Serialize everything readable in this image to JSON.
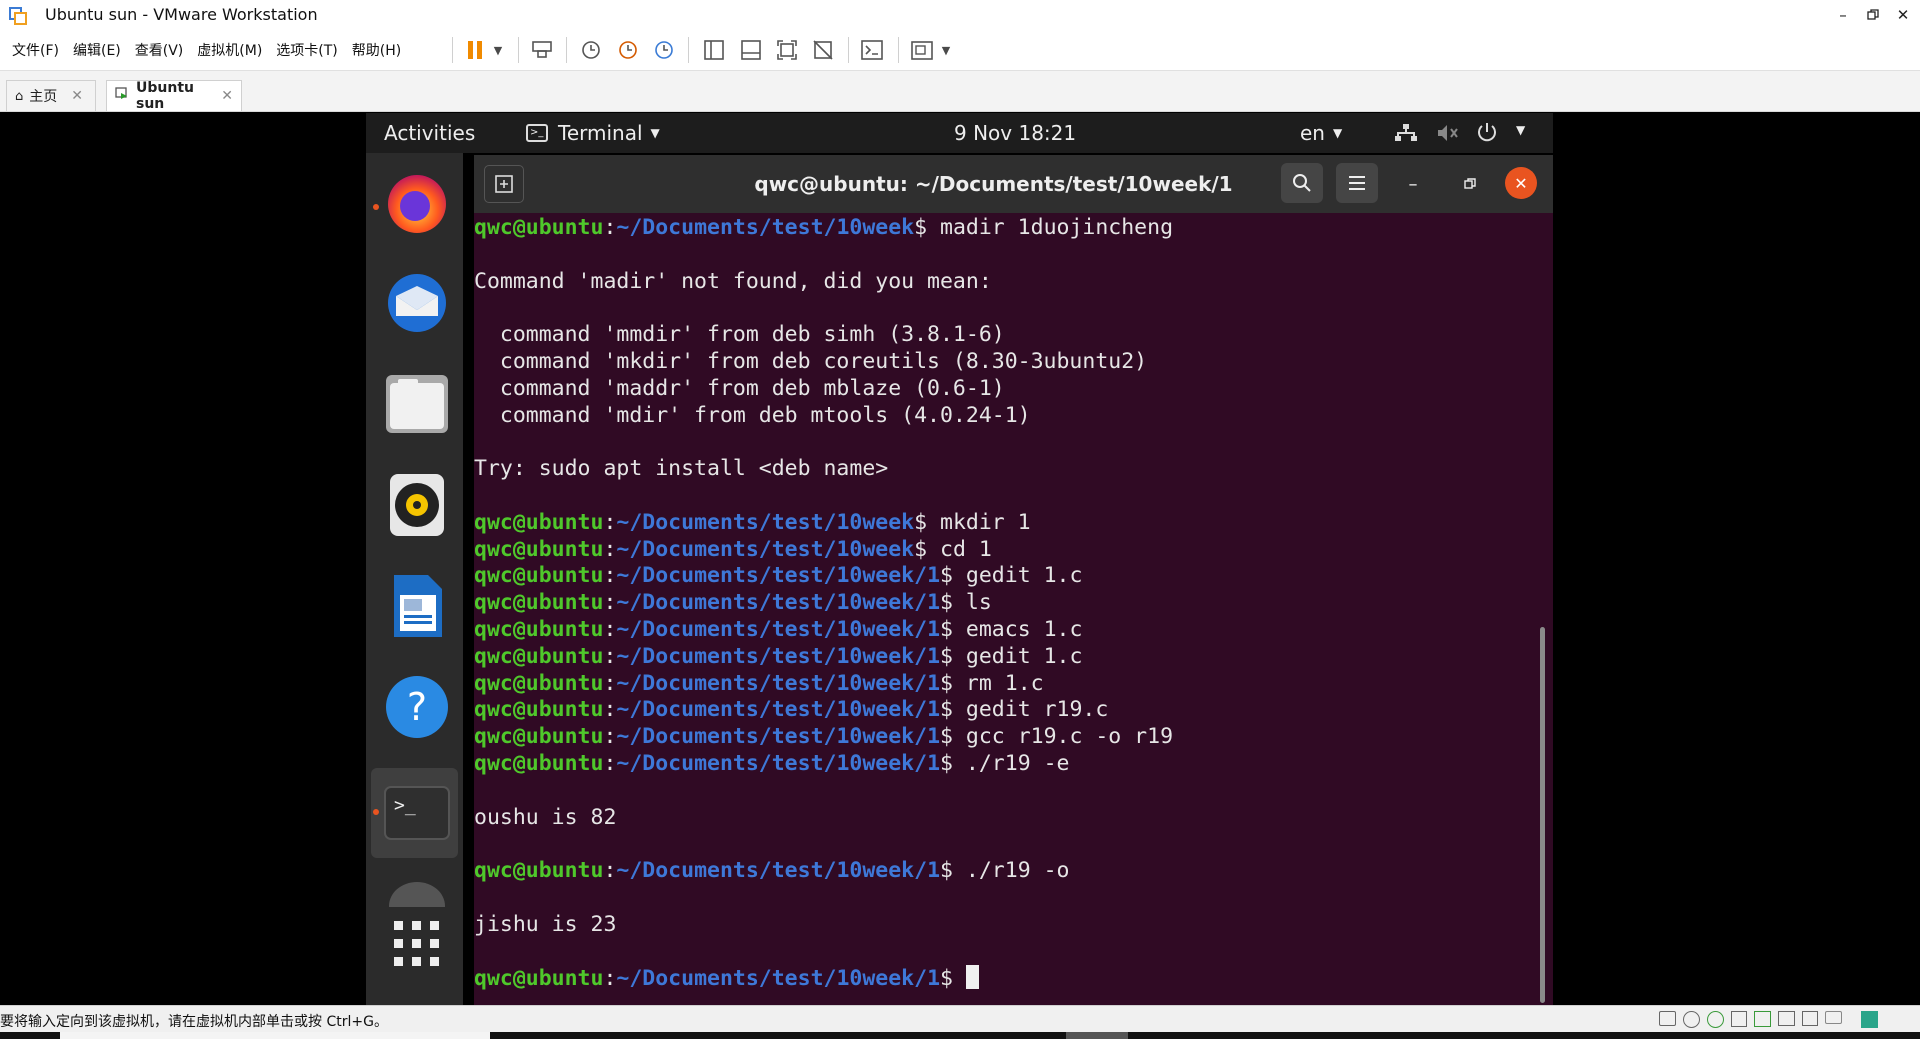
{
  "window": {
    "title": "Ubuntu sun - VMware Workstation"
  },
  "menu": {
    "items": [
      "文件(F)",
      "编辑(E)",
      "查看(V)",
      "虚拟机(M)",
      "选项卡(T)",
      "帮助(H)"
    ]
  },
  "tabs": [
    {
      "label": "主页",
      "active": false
    },
    {
      "label": "Ubuntu sun",
      "active": true
    }
  ],
  "ubuntu_topbar": {
    "activities": "Activities",
    "app_menu": "Terminal",
    "datetime": "9 Nov  18:21",
    "language": "en"
  },
  "terminal": {
    "title": "qwc@ubuntu: ~/Documents/test/10week/1",
    "lines": [
      {
        "type": "prompt",
        "user": "qwc@ubuntu",
        "path": "~/Documents/test/10week",
        "cmd": " madir 1duojincheng"
      },
      {
        "type": "blank"
      },
      {
        "type": "output",
        "text": "Command 'madir' not found, did you mean:"
      },
      {
        "type": "blank"
      },
      {
        "type": "output",
        "text": "  command 'mmdir' from deb simh (3.8.1-6)"
      },
      {
        "type": "output",
        "text": "  command 'mkdir' from deb coreutils (8.30-3ubuntu2)"
      },
      {
        "type": "output",
        "text": "  command 'maddr' from deb mblaze (0.6-1)"
      },
      {
        "type": "output",
        "text": "  command 'mdir' from deb mtools (4.0.24-1)"
      },
      {
        "type": "blank"
      },
      {
        "type": "output",
        "text": "Try: sudo apt install <deb name>"
      },
      {
        "type": "blank"
      },
      {
        "type": "prompt",
        "user": "qwc@ubuntu",
        "path": "~/Documents/test/10week",
        "cmd": " mkdir 1"
      },
      {
        "type": "prompt",
        "user": "qwc@ubuntu",
        "path": "~/Documents/test/10week",
        "cmd": " cd 1"
      },
      {
        "type": "prompt",
        "user": "qwc@ubuntu",
        "path": "~/Documents/test/10week/1",
        "cmd": " gedit 1.c"
      },
      {
        "type": "prompt",
        "user": "qwc@ubuntu",
        "path": "~/Documents/test/10week/1",
        "cmd": " ls"
      },
      {
        "type": "prompt",
        "user": "qwc@ubuntu",
        "path": "~/Documents/test/10week/1",
        "cmd": " emacs 1.c"
      },
      {
        "type": "prompt",
        "user": "qwc@ubuntu",
        "path": "~/Documents/test/10week/1",
        "cmd": " gedit 1.c"
      },
      {
        "type": "prompt",
        "user": "qwc@ubuntu",
        "path": "~/Documents/test/10week/1",
        "cmd": " rm 1.c"
      },
      {
        "type": "prompt",
        "user": "qwc@ubuntu",
        "path": "~/Documents/test/10week/1",
        "cmd": " gedit r19.c"
      },
      {
        "type": "prompt",
        "user": "qwc@ubuntu",
        "path": "~/Documents/test/10week/1",
        "cmd": " gcc r19.c -o r19"
      },
      {
        "type": "prompt",
        "user": "qwc@ubuntu",
        "path": "~/Documents/test/10week/1",
        "cmd": " ./r19 -e"
      },
      {
        "type": "blank"
      },
      {
        "type": "output",
        "text": "oushu is 82"
      },
      {
        "type": "blank"
      },
      {
        "type": "prompt",
        "user": "qwc@ubuntu",
        "path": "~/Documents/test/10week/1",
        "cmd": " ./r19 -o"
      },
      {
        "type": "blank"
      },
      {
        "type": "output",
        "text": "jishu is 23"
      },
      {
        "type": "blank"
      },
      {
        "type": "prompt",
        "user": "qwc@ubuntu",
        "path": "~/Documents/test/10week/1",
        "cmd": " ",
        "cursor": true
      }
    ]
  },
  "statusbar": {
    "text": "要将输入定向到该虚拟机，请在虚拟机内部单击或按 Ctrl+G。"
  },
  "colors": {
    "terminal_bg": "#300a24",
    "prompt_user": "#4fc82b",
    "prompt_path": "#3e78d8",
    "close_button": "#e95420"
  }
}
